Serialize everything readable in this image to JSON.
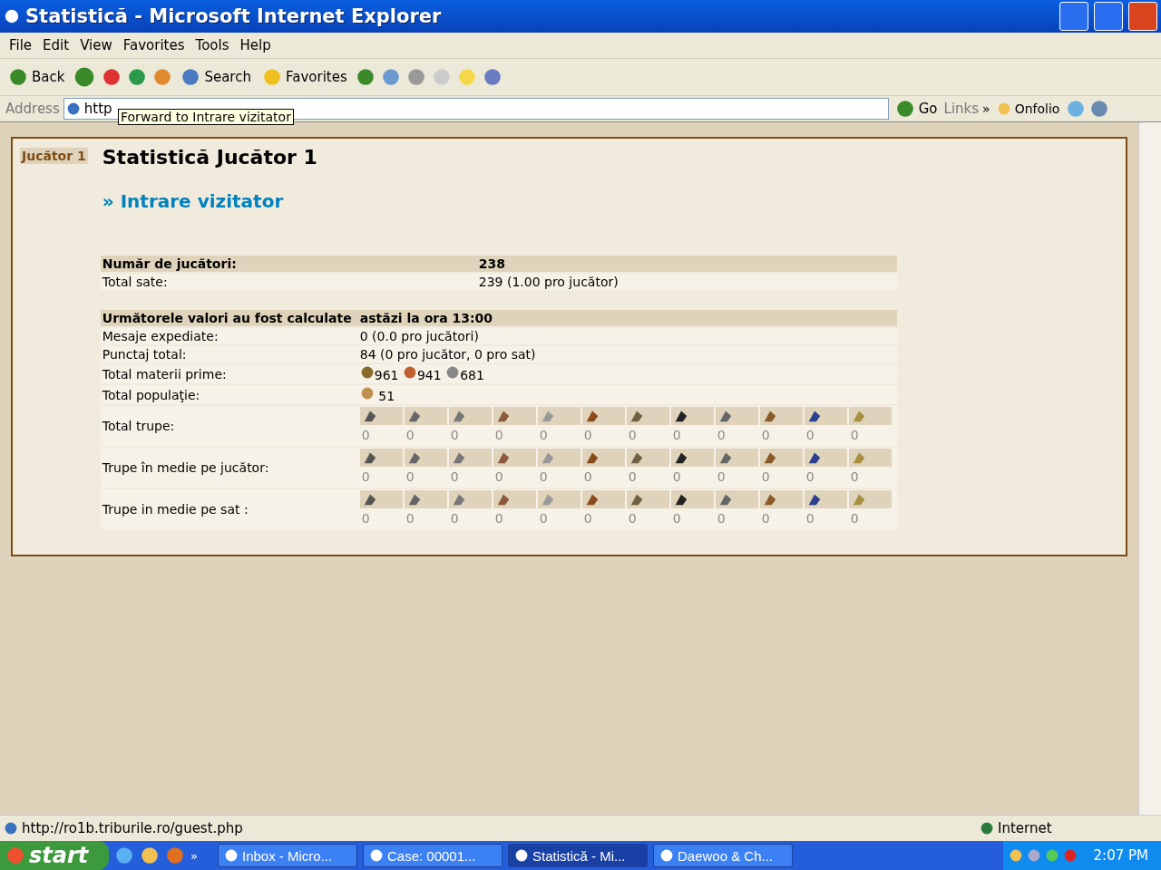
{
  "window": {
    "title": "Statistică - Microsoft Internet Explorer"
  },
  "menu": [
    "File",
    "Edit",
    "View",
    "Favorites",
    "Tools",
    "Help"
  ],
  "toolbar": {
    "back": "Back",
    "search": "Search",
    "favorites": "Favorites"
  },
  "address": {
    "label": "Address",
    "value": "http",
    "go": "Go",
    "links": "Links",
    "chevron": "»",
    "onfolio": "Onfolio"
  },
  "tooltip": "Forward to Intrare vizitator",
  "page": {
    "badge": "Jucător 1",
    "title": "Statistică Jucător 1",
    "link": "» Intrare vizitator",
    "summary": [
      {
        "label": "Număr de jucători:",
        "value": "238",
        "header": true
      },
      {
        "label": "Total sate:",
        "value": "239 (1.00 pro jucător)",
        "header": false
      }
    ],
    "calc_header": {
      "label": "Următorele valori au fost calculate",
      "value": "astăzi la ora 13:00"
    },
    "stats": [
      {
        "label": "Mesaje expediate:",
        "value": "0 (0.0 pro jucători)"
      },
      {
        "label": "Punctaj total:",
        "value": "84 (0 pro jucător, 0 pro sat)"
      }
    ],
    "resources": {
      "label": "Total materii prime:",
      "wood": "961",
      "clay": "941",
      "iron": "681"
    },
    "population": {
      "label": "Total populaţie:",
      "value": "51"
    },
    "troops": [
      {
        "label": "Total trupe:",
        "counts": [
          "0",
          "0",
          "0",
          "0",
          "0",
          "0",
          "0",
          "0",
          "0",
          "0",
          "0",
          "0"
        ]
      },
      {
        "label": "Trupe în medie pe jucător:",
        "counts": [
          "0",
          "0",
          "0",
          "0",
          "0",
          "0",
          "0",
          "0",
          "0",
          "0",
          "0",
          "0"
        ]
      },
      {
        "label": "Trupe in medie pe sat :",
        "counts": [
          "0",
          "0",
          "0",
          "0",
          "0",
          "0",
          "0",
          "0",
          "0",
          "0",
          "0",
          "0"
        ]
      }
    ]
  },
  "status_bar": {
    "url": "http://ro1b.triburile.ro/guest.php",
    "zone": "Internet"
  },
  "taskbar": {
    "start": "start",
    "chevron": "»",
    "tasks": [
      {
        "label": "Inbox - Micro...",
        "selected": false
      },
      {
        "label": "Case: 00001...",
        "selected": false
      },
      {
        "label": "Statistică - Mi...",
        "selected": true
      },
      {
        "label": "Daewoo & Ch...",
        "selected": false
      }
    ],
    "clock": "2:07 PM"
  }
}
